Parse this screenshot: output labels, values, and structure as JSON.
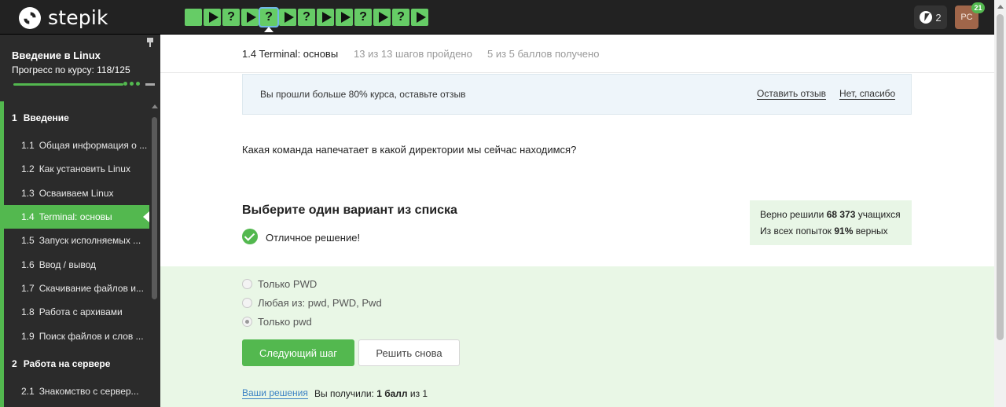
{
  "app": {
    "logo_text": "stepik"
  },
  "steps": [
    {
      "kind": "text"
    },
    {
      "kind": "video"
    },
    {
      "kind": "quiz",
      "label": "?"
    },
    {
      "kind": "video"
    },
    {
      "kind": "quiz",
      "label": "?",
      "current": true
    },
    {
      "kind": "video"
    },
    {
      "kind": "quiz",
      "label": "?"
    },
    {
      "kind": "video"
    },
    {
      "kind": "video"
    },
    {
      "kind": "quiz",
      "label": "?"
    },
    {
      "kind": "video"
    },
    {
      "kind": "quiz",
      "label": "?"
    },
    {
      "kind": "video"
    }
  ],
  "header": {
    "streak_count": "2",
    "avatar_initials": "РС",
    "notification_count": "21"
  },
  "sidebar": {
    "course_title": "Введение в Linux",
    "progress_text": "Прогресс по курсу:  118/125",
    "sections": [
      {
        "num": "1",
        "title": "Введение",
        "lessons": [
          {
            "num": "1.1",
            "title": "Общая информация о ..."
          },
          {
            "num": "1.2",
            "title": "Как установить Linux"
          },
          {
            "num": "1.3",
            "title": "Осваиваем Linux"
          },
          {
            "num": "1.4",
            "title": "Terminal: основы",
            "active": true
          },
          {
            "num": "1.5",
            "title": "Запуск исполняемых ..."
          },
          {
            "num": "1.6",
            "title": "Ввод / вывод"
          },
          {
            "num": "1.7",
            "title": "Скачивание файлов и..."
          },
          {
            "num": "1.8",
            "title": "Работа с архивами"
          },
          {
            "num": "1.9",
            "title": "Поиск файлов и слов ..."
          }
        ]
      },
      {
        "num": "2",
        "title": "Работа на сервере",
        "lessons": [
          {
            "num": "2.1",
            "title": "Знакомство с сервер..."
          }
        ]
      }
    ]
  },
  "lesson": {
    "name": "1.4 Terminal: основы",
    "steps_done": "13 из 13 шагов пройдено",
    "score": "5 из 5 баллов  получено"
  },
  "feedback": {
    "text": "Вы прошли больше 80% курса, оставьте отзыв",
    "leave_label": "Оставить отзыв",
    "no_label": "Нет, спасибо"
  },
  "question": "Какая команда напечатает в какой директории мы сейчас находимся?",
  "quiz": {
    "title": "Выберите один вариант из списка",
    "success": "Отличное решение!",
    "stats": {
      "solved_prefix": "Верно решили ",
      "solved_count": "68 373",
      "solved_suffix": " учащихся",
      "attempts_prefix": "Из всех попыток ",
      "attempts_percent": "91%",
      "attempts_suffix": " верных"
    },
    "options": [
      {
        "label": "Только PWD",
        "checked": false
      },
      {
        "label": "Любая из: pwd, PWD, Pwd",
        "checked": false
      },
      {
        "label": "Только pwd",
        "checked": true
      }
    ],
    "next_label": "Следующий шаг",
    "retry_label": "Решить снова",
    "solutions_label": "Ваши решения",
    "score_prefix": "Вы получили: ",
    "score_value": "1 балл",
    "score_suffix": " из 1"
  },
  "colors": {
    "accent": "#53b84f",
    "topbar": "#222222",
    "sidebar": "#2b2b2b",
    "link": "#3b82c4"
  }
}
